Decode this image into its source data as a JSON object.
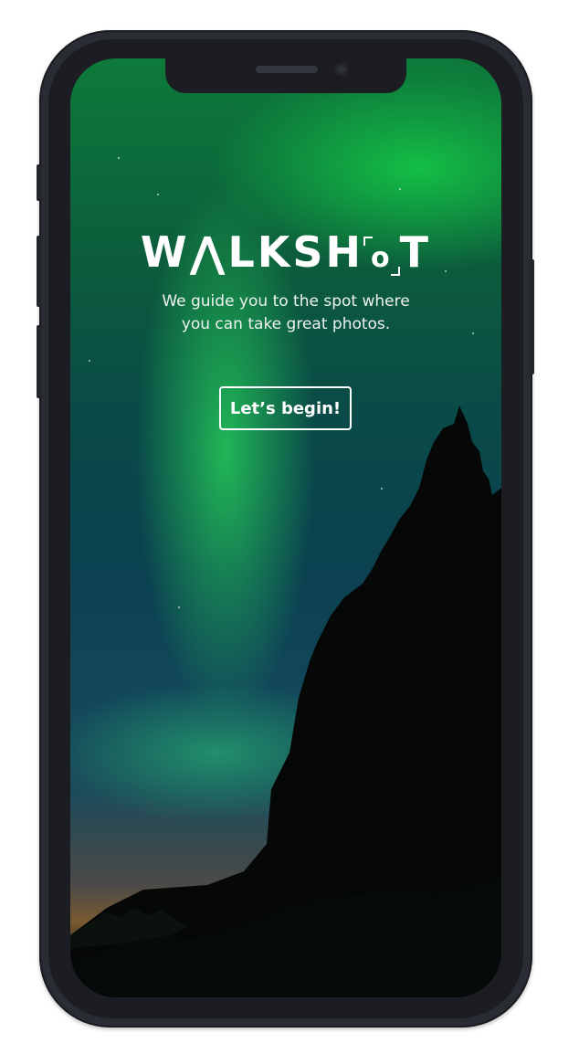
{
  "app": {
    "logo": {
      "part1": "W",
      "part2": "LKSH",
      "part3": "o",
      "part4": "T"
    },
    "tagline": [
      "We guide you to the spot where",
      "you can take great photos."
    ],
    "cta_label": "Let’s begin!"
  },
  "colors": {
    "accent": "#1fbf55",
    "frame": "#2a2c33",
    "text": "#ffffff"
  }
}
